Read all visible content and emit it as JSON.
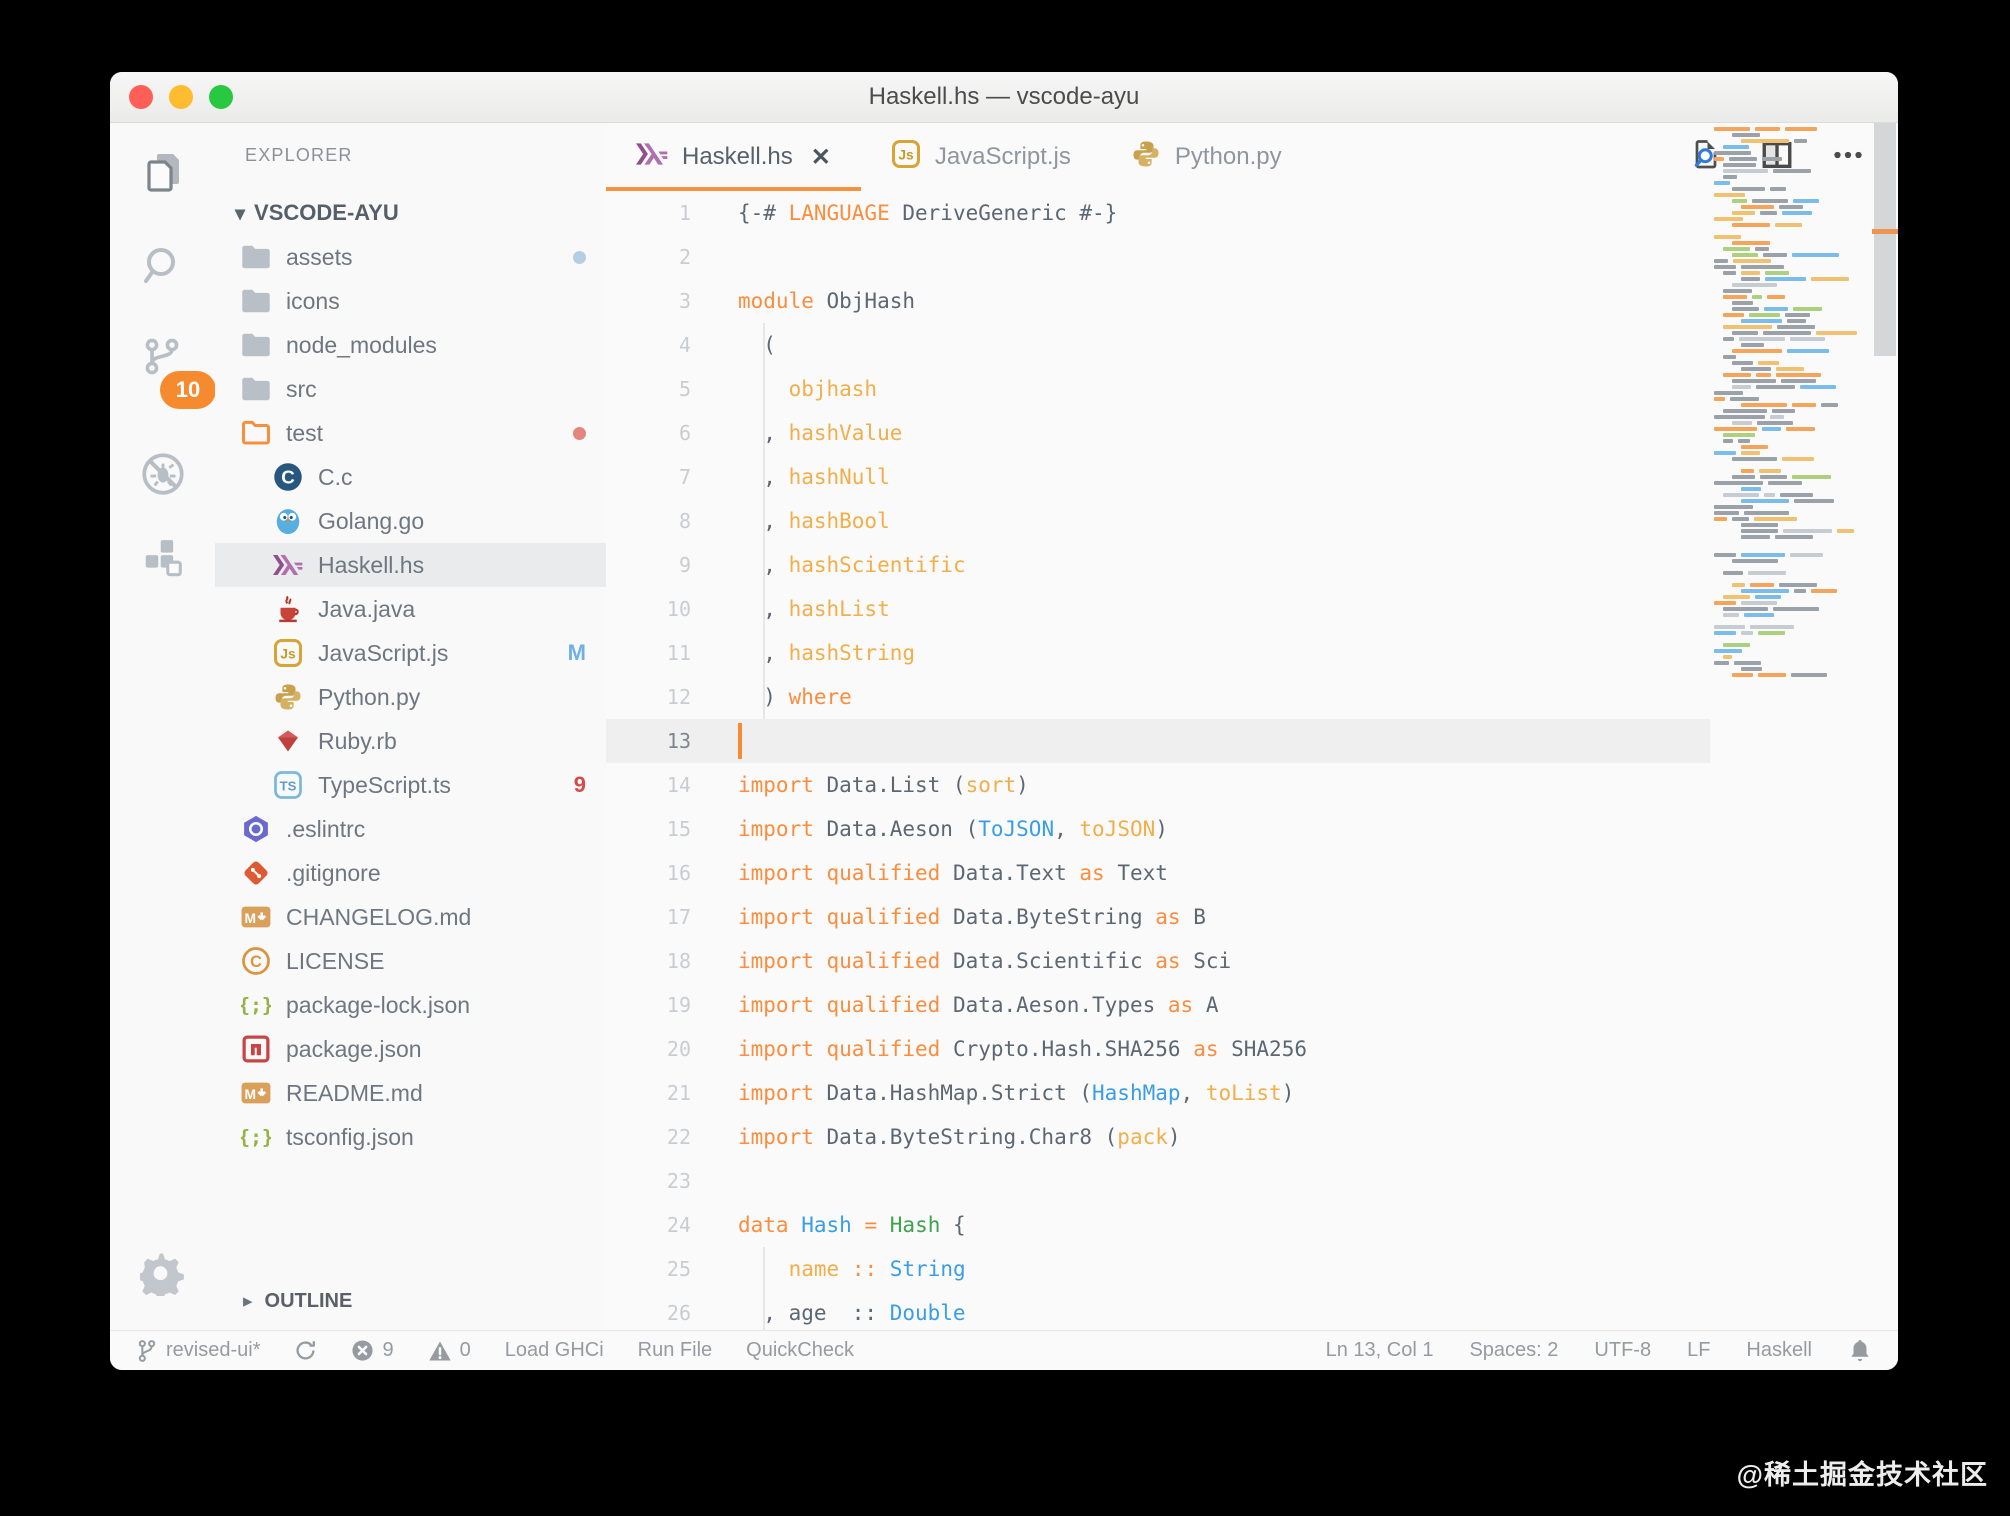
{
  "window": {
    "title": "Haskell.hs — vscode-ayu"
  },
  "activity_bar": {
    "scm_badge": "10",
    "items": [
      "explorer",
      "search",
      "source-control",
      "debug-off",
      "extensions"
    ],
    "settings": "settings"
  },
  "sidebar": {
    "header": "EXPLORER",
    "root": "VSCODE-AYU",
    "outline_label": "OUTLINE",
    "items": [
      {
        "label": "assets",
        "icon": "folder",
        "level": 1,
        "badge": {
          "type": "dot",
          "color": "#b5cee3"
        }
      },
      {
        "label": "icons",
        "icon": "folder",
        "level": 1
      },
      {
        "label": "node_modules",
        "icon": "folder",
        "level": 1
      },
      {
        "label": "src",
        "icon": "folder",
        "level": 1
      },
      {
        "label": "test",
        "icon": "folder-open",
        "level": 1,
        "badge": {
          "type": "dot",
          "color": "#e2867e"
        }
      },
      {
        "label": "C.c",
        "icon": "c",
        "level": 2
      },
      {
        "label": "Golang.go",
        "icon": "go",
        "level": 2
      },
      {
        "label": "Haskell.hs",
        "icon": "haskell",
        "level": 2,
        "selected": true
      },
      {
        "label": "Java.java",
        "icon": "java",
        "level": 2
      },
      {
        "label": "JavaScript.js",
        "icon": "js",
        "level": 2,
        "badge": {
          "type": "text",
          "text": "M",
          "color": "#6fb1e4"
        }
      },
      {
        "label": "Python.py",
        "icon": "python",
        "level": 2
      },
      {
        "label": "Ruby.rb",
        "icon": "ruby",
        "level": 2
      },
      {
        "label": "TypeScript.ts",
        "icon": "ts",
        "level": 2,
        "badge": {
          "type": "text",
          "text": "9",
          "color": "#d84a4a"
        }
      },
      {
        "label": ".eslintrc",
        "icon": "eslint",
        "level": 1
      },
      {
        "label": ".gitignore",
        "icon": "git",
        "level": 1
      },
      {
        "label": "CHANGELOG.md",
        "icon": "md",
        "level": 1
      },
      {
        "label": "LICENSE",
        "icon": "license",
        "level": 1
      },
      {
        "label": "package-lock.json",
        "icon": "json",
        "level": 1
      },
      {
        "label": "package.json",
        "icon": "npm",
        "level": 1
      },
      {
        "label": "README.md",
        "icon": "md",
        "level": 1
      },
      {
        "label": "tsconfig.json",
        "icon": "json",
        "level": 1
      }
    ]
  },
  "tabs": [
    {
      "label": "Haskell.hs",
      "icon": "haskell",
      "active": true,
      "close": "✕"
    },
    {
      "label": "JavaScript.js",
      "icon": "js",
      "active": false
    },
    {
      "label": "Python.py",
      "icon": "python",
      "active": false
    }
  ],
  "editor": {
    "current_line": 13,
    "lines": [
      {
        "n": 1,
        "tokens": [
          [
            "d",
            "{-# "
          ],
          [
            "k",
            "LANGUAGE"
          ],
          [
            "d",
            " DeriveGeneric #-}"
          ]
        ]
      },
      {
        "n": 2,
        "tokens": []
      },
      {
        "n": 3,
        "tokens": [
          [
            "k",
            "module"
          ],
          [
            "d",
            " ObjHash"
          ]
        ]
      },
      {
        "n": 4,
        "tokens": [
          [
            "d",
            "  ("
          ]
        ]
      },
      {
        "n": 5,
        "tokens": [
          [
            "d",
            "    "
          ],
          [
            "f",
            "objhash"
          ]
        ]
      },
      {
        "n": 6,
        "tokens": [
          [
            "d",
            "  , "
          ],
          [
            "f",
            "hashValue"
          ]
        ]
      },
      {
        "n": 7,
        "tokens": [
          [
            "d",
            "  , "
          ],
          [
            "f",
            "hashNull"
          ]
        ]
      },
      {
        "n": 8,
        "tokens": [
          [
            "d",
            "  , "
          ],
          [
            "f",
            "hashBool"
          ]
        ]
      },
      {
        "n": 9,
        "tokens": [
          [
            "d",
            "  , "
          ],
          [
            "f",
            "hashScientific"
          ]
        ]
      },
      {
        "n": 10,
        "tokens": [
          [
            "d",
            "  , "
          ],
          [
            "f",
            "hashList"
          ]
        ]
      },
      {
        "n": 11,
        "tokens": [
          [
            "d",
            "  , "
          ],
          [
            "f",
            "hashString"
          ]
        ]
      },
      {
        "n": 12,
        "tokens": [
          [
            "d",
            "  ) "
          ],
          [
            "k",
            "where"
          ]
        ]
      },
      {
        "n": 13,
        "tokens": []
      },
      {
        "n": 14,
        "tokens": [
          [
            "k",
            "import"
          ],
          [
            "d",
            " Data.List ("
          ],
          [
            "f",
            "sort"
          ],
          [
            "d",
            ")"
          ]
        ]
      },
      {
        "n": 15,
        "tokens": [
          [
            "k",
            "import"
          ],
          [
            "d",
            " Data.Aeson ("
          ],
          [
            "t",
            "ToJSON"
          ],
          [
            "d",
            ", "
          ],
          [
            "f",
            "toJSON"
          ],
          [
            "d",
            ")"
          ]
        ]
      },
      {
        "n": 16,
        "tokens": [
          [
            "k",
            "import"
          ],
          [
            "d",
            " "
          ],
          [
            "k",
            "qualified"
          ],
          [
            "d",
            " Data.Text "
          ],
          [
            "k",
            "as"
          ],
          [
            "d",
            " Text"
          ]
        ]
      },
      {
        "n": 17,
        "tokens": [
          [
            "k",
            "import"
          ],
          [
            "d",
            " "
          ],
          [
            "k",
            "qualified"
          ],
          [
            "d",
            " Data.ByteString "
          ],
          [
            "k",
            "as"
          ],
          [
            "d",
            " B"
          ]
        ]
      },
      {
        "n": 18,
        "tokens": [
          [
            "k",
            "import"
          ],
          [
            "d",
            " "
          ],
          [
            "k",
            "qualified"
          ],
          [
            "d",
            " Data.Scientific "
          ],
          [
            "k",
            "as"
          ],
          [
            "d",
            " Sci"
          ]
        ]
      },
      {
        "n": 19,
        "tokens": [
          [
            "k",
            "import"
          ],
          [
            "d",
            " "
          ],
          [
            "k",
            "qualified"
          ],
          [
            "d",
            " Data.Aeson.Types "
          ],
          [
            "k",
            "as"
          ],
          [
            "d",
            " A"
          ]
        ]
      },
      {
        "n": 20,
        "tokens": [
          [
            "k",
            "import"
          ],
          [
            "d",
            " "
          ],
          [
            "k",
            "qualified"
          ],
          [
            "d",
            " Crypto.Hash.SHA256 "
          ],
          [
            "k",
            "as"
          ],
          [
            "d",
            " SHA256"
          ]
        ]
      },
      {
        "n": 21,
        "tokens": [
          [
            "k",
            "import"
          ],
          [
            "d",
            " Data.HashMap.Strict ("
          ],
          [
            "t",
            "HashMap"
          ],
          [
            "d",
            ", "
          ],
          [
            "f",
            "toList"
          ],
          [
            "d",
            ")"
          ]
        ]
      },
      {
        "n": 22,
        "tokens": [
          [
            "k",
            "import"
          ],
          [
            "d",
            " Data.ByteString.Char8 ("
          ],
          [
            "f",
            "pack"
          ],
          [
            "d",
            ")"
          ]
        ]
      },
      {
        "n": 23,
        "tokens": []
      },
      {
        "n": 24,
        "tokens": [
          [
            "k",
            "data"
          ],
          [
            "d",
            " "
          ],
          [
            "t",
            "Hash"
          ],
          [
            "d",
            " "
          ],
          [
            "k",
            "="
          ],
          [
            "d",
            " "
          ],
          [
            "c",
            "Hash"
          ],
          [
            "d",
            " {"
          ]
        ]
      },
      {
        "n": 25,
        "tokens": [
          [
            "d",
            "    "
          ],
          [
            "f",
            "name"
          ],
          [
            "d",
            " "
          ],
          [
            "k",
            "::"
          ],
          [
            "d",
            " "
          ],
          [
            "t",
            "String"
          ]
        ]
      },
      {
        "n": 26,
        "tokens": [
          [
            "d",
            "  , age  :: "
          ],
          [
            "t",
            "Double"
          ]
        ]
      }
    ]
  },
  "status_bar": {
    "left": [
      {
        "id": "branch",
        "icon": "branch",
        "label": "revised-ui*"
      },
      {
        "id": "sync",
        "icon": "sync",
        "label": ""
      },
      {
        "id": "errors",
        "icon": "error",
        "label": "9"
      },
      {
        "id": "warnings",
        "icon": "warning",
        "label": "0"
      },
      {
        "id": "load-ghci",
        "label": "Load GHCi"
      },
      {
        "id": "run-file",
        "label": "Run File"
      },
      {
        "id": "quickcheck",
        "label": "QuickCheck"
      }
    ],
    "right": [
      {
        "id": "cursor-position",
        "label": "Ln 13, Col 1"
      },
      {
        "id": "indentation",
        "label": "Spaces: 2"
      },
      {
        "id": "encoding",
        "label": "UTF-8"
      },
      {
        "id": "eol",
        "label": "LF"
      },
      {
        "id": "language-mode",
        "label": "Haskell"
      },
      {
        "id": "notifications",
        "icon": "bell",
        "label": ""
      }
    ]
  },
  "colors": {
    "accent_orange": "#fa8d3e",
    "token_function": "#f2ae49",
    "token_type": "#399ee6",
    "token_constructor": "#3fa34d",
    "editor_fg": "#5c6773",
    "badge_orange": "#f68a2e",
    "badge_modified_blue": "#6fb1e4",
    "badge_error_red": "#d84a4a"
  },
  "watermark": "@稀土掘金技术社区"
}
